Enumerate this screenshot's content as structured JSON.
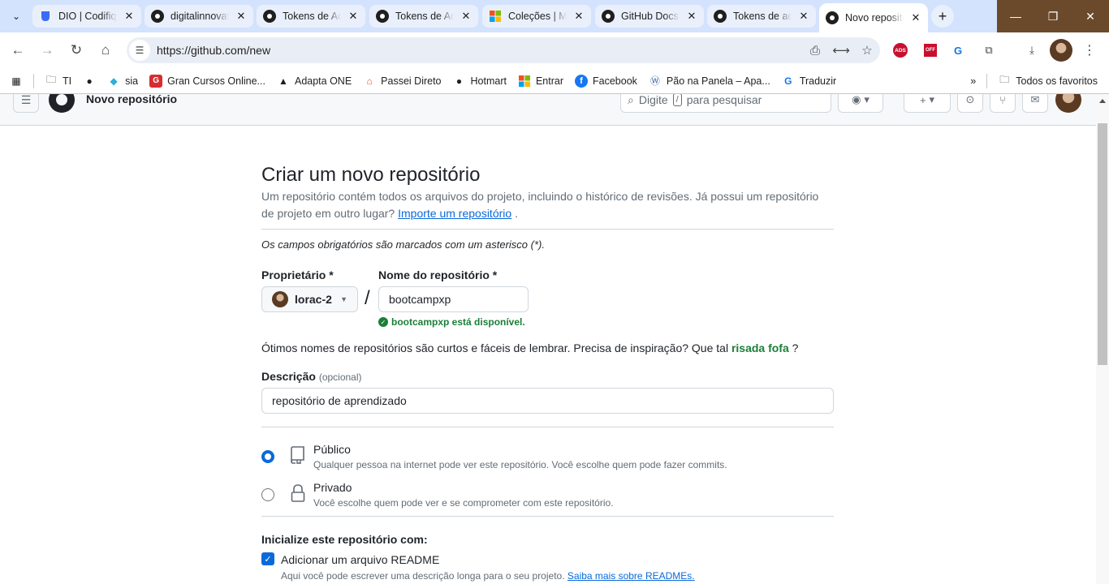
{
  "browser": {
    "tabs": [
      {
        "title": "DIO | Codifique o seu futuro",
        "favicon": "dio-icon"
      },
      {
        "title": "digitalinnovationone",
        "favicon": "github-icon"
      },
      {
        "title": "Tokens de Acesso",
        "favicon": "github-icon"
      },
      {
        "title": "Tokens de Acesso",
        "favicon": "github-icon"
      },
      {
        "title": "Coleções | Microsoft",
        "favicon": "microsoft-icon"
      },
      {
        "title": "GitHub Docs",
        "favicon": "github-icon"
      },
      {
        "title": "Tokens de acesso",
        "favicon": "github-icon"
      },
      {
        "title": "Novo repositório",
        "favicon": "github-icon",
        "active": true
      }
    ],
    "url": "https://github.com/new",
    "bookmarks": [
      {
        "label": "TI",
        "icon": "folder-icon"
      },
      {
        "label": "",
        "icon": "globe-icon"
      },
      {
        "label": "sia",
        "icon": "sia-icon"
      },
      {
        "label": "Gran Cursos Online...",
        "icon": "gran-icon"
      },
      {
        "label": "Adapta ONE",
        "icon": "adapta-icon"
      },
      {
        "label": "Passei Direto",
        "icon": "passei-icon"
      },
      {
        "label": "Hotmart",
        "icon": "globe-icon"
      },
      {
        "label": "Entrar",
        "icon": "microsoft-icon"
      },
      {
        "label": "Facebook",
        "icon": "facebook-icon"
      },
      {
        "label": "Pão na Panela – Apa...",
        "icon": "wordpress-icon"
      },
      {
        "label": "Traduzir",
        "icon": "translate-icon"
      }
    ],
    "all_bookmarks_label": "Todos os favoritos",
    "ext_ads_label": "ADS",
    "ext_off_label": "OFF"
  },
  "github_header": {
    "context_title": "Novo repositório",
    "search_prefix": "Digite",
    "search_key": "/",
    "search_suffix": "para pesquisar"
  },
  "form": {
    "title": "Criar um novo repositório",
    "intro": "Um repositório contém todos os arquivos do projeto, incluindo o histórico de revisões. Já possui um repositório de projeto em outro lugar?",
    "import_link": "Importe um repositório",
    "intro_end": ".",
    "required_note": "Os campos obrigatórios são marcados com um asterisco (*).",
    "owner_label": "Proprietário *",
    "owner_value": "lorac-2",
    "repo_label": "Nome do repositório *",
    "repo_value": "bootcampxp",
    "availability": "bootcampxp está disponível.",
    "tip_prefix": "Ótimos nomes de repositórios são curtos e fáceis de lembrar. Precisa de inspiração? Que tal",
    "tip_suggestion": "risada fofa",
    "tip_suffix": "?",
    "description_label": "Descrição",
    "description_optional": "(opcional)",
    "description_value": "repositório de aprendizado",
    "visibility": [
      {
        "title": "Público",
        "desc": "Qualquer pessoa na internet pode ver este repositório. Você escolhe quem pode fazer commits.",
        "selected": true,
        "icon": "repo-icon"
      },
      {
        "title": "Privado",
        "desc": "Você escolhe quem pode ver e se comprometer com este repositório.",
        "selected": false,
        "icon": "lock-icon"
      }
    ],
    "init_title": "Inicialize este repositório com:",
    "readme_label": "Adicionar um arquivo README",
    "readme_checked": true,
    "readme_desc": "Aqui você pode escrever uma descrição longa para o seu projeto.",
    "readme_link": "Saiba mais sobre READMEs."
  },
  "colors": {
    "accent": "#0969da",
    "success": "#1a7f37",
    "chrome_tabbar": "#d3e3fd"
  }
}
